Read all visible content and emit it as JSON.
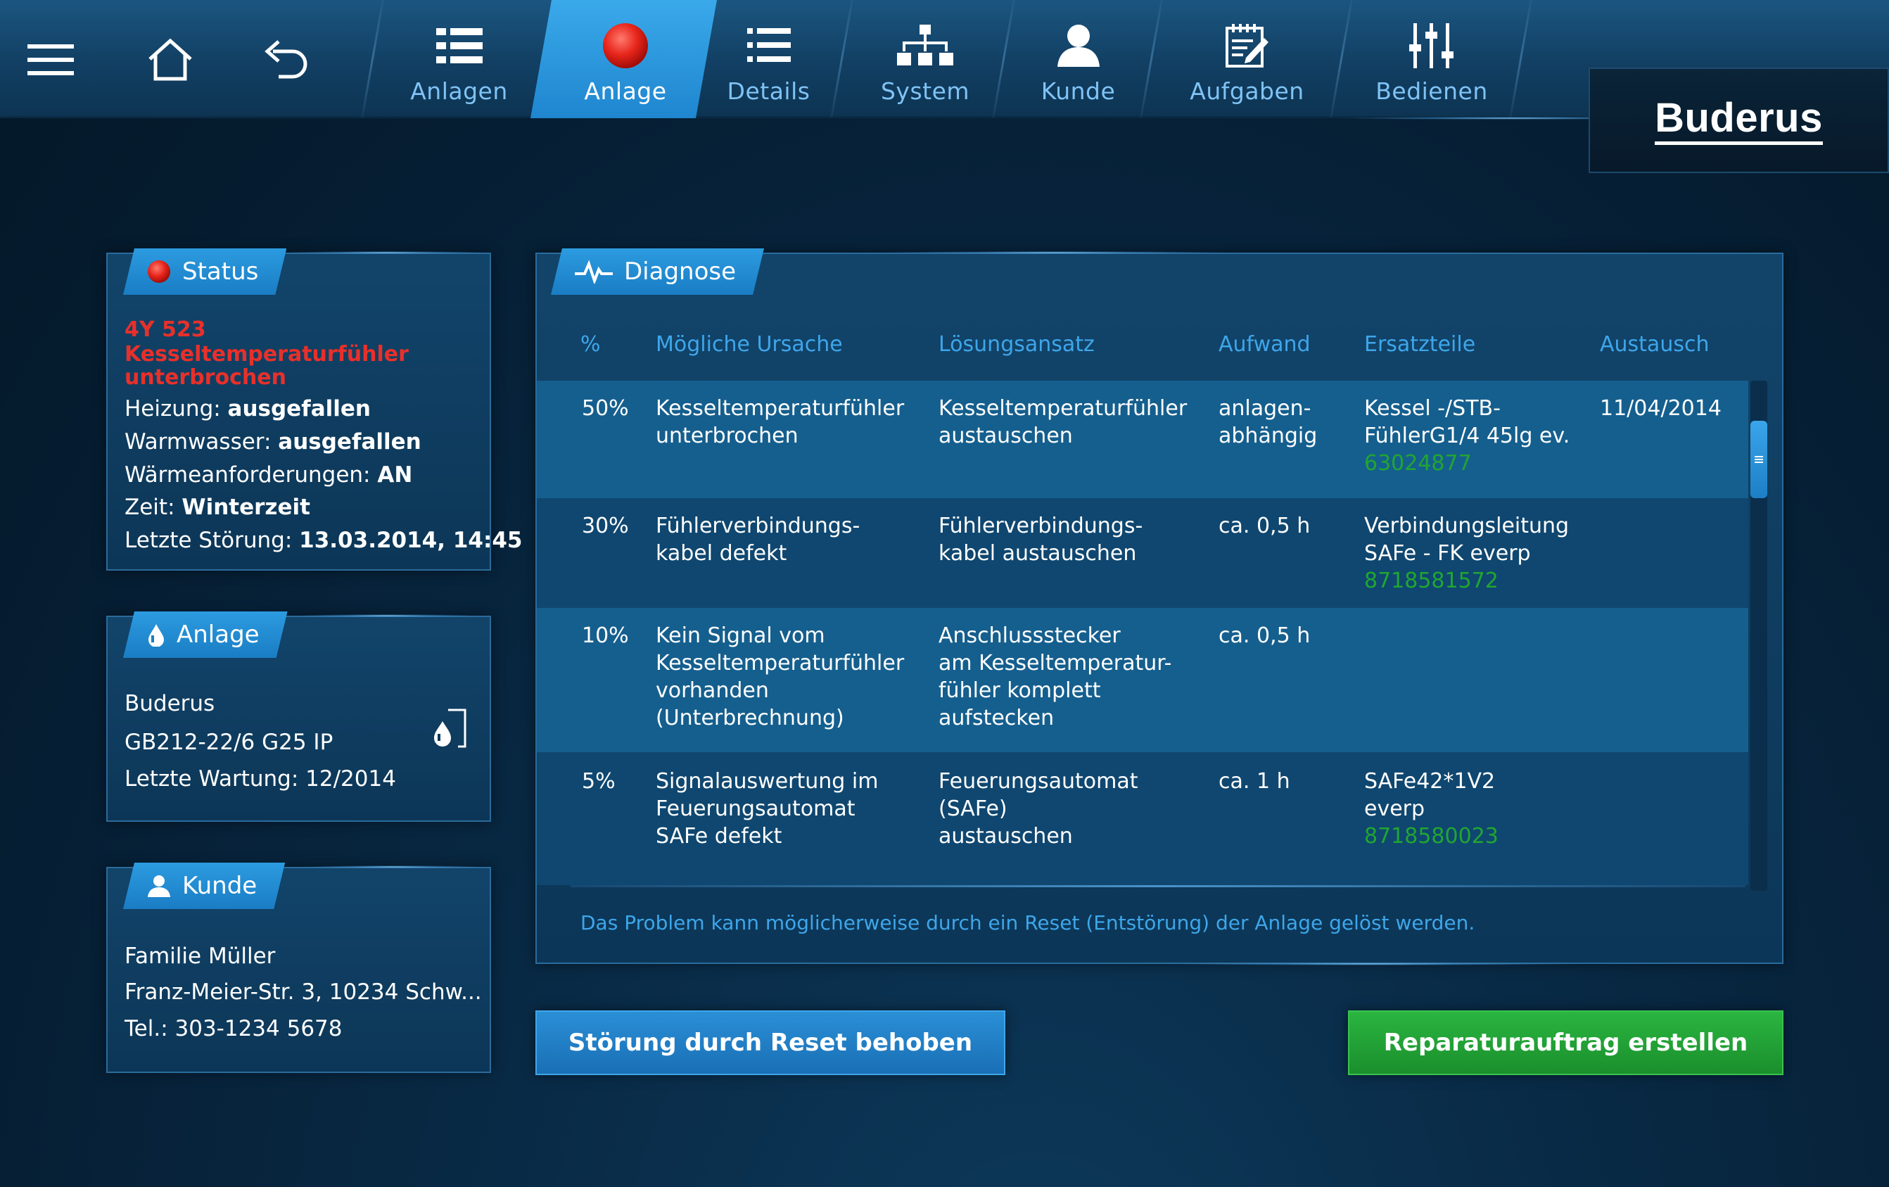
{
  "nav": {
    "tabs": [
      {
        "label": "Anlagen",
        "icon": "grid-icon"
      },
      {
        "label": "Anlage",
        "icon": "red-dot-icon"
      },
      {
        "label": "Details",
        "icon": "list-icon"
      },
      {
        "label": "System",
        "icon": "hierarchy-icon"
      },
      {
        "label": "Kunde",
        "icon": "person-icon"
      },
      {
        "label": "Aufgaben",
        "icon": "task-edit-icon"
      },
      {
        "label": "Bedienen",
        "icon": "sliders-icon"
      }
    ],
    "active_tab": "Anlage",
    "brand": "Buderus"
  },
  "status": {
    "title": "Status",
    "error_code": "4Y 523",
    "error_line1": "Kesseltemperaturfühler",
    "error_line2": "unterbrochen",
    "heizung_label": "Heizung:",
    "heizung_value": "ausgefallen",
    "warmwasser_label": "Warmwasser:",
    "warmwasser_value": "ausgefallen",
    "waerme_label": "Wärmeanforderungen:",
    "waerme_value": "AN",
    "zeit_label": "Zeit:",
    "zeit_value": "Winterzeit",
    "stoerung_label": "Letzte Störung:",
    "stoerung_value": "13.03.2014, 14:45"
  },
  "anlage": {
    "title": "Anlage",
    "maker": "Buderus",
    "model": "GB212-22/6 G25 IP",
    "wartung": "Letzte Wartung: 12/2014"
  },
  "kunde": {
    "title": "Kunde",
    "name": "Familie Müller",
    "address": "Franz-Meier-Str. 3, 10234 Schw...",
    "phone": "Tel.: 303-1234 5678"
  },
  "diagnose": {
    "title": "Diagnose",
    "headers": [
      "%",
      "Mögliche Ursache",
      "Lösungsansatz",
      "Aufwand",
      "Ersatzteile",
      "Austausch"
    ],
    "rows": [
      {
        "pct": "50%",
        "ursache": [
          "Kesseltemperaturfühler",
          "unterbrochen"
        ],
        "loesung": [
          "Kesseltemperaturfühler",
          "austauschen"
        ],
        "aufwand": [
          "anlagen-",
          "abhängig"
        ],
        "teile": [
          "Kessel -/STB-",
          "FühlerG1/4 45lg ev."
        ],
        "teilnr": "63024877",
        "austausch": "11/04/2014"
      },
      {
        "pct": "30%",
        "ursache": [
          "Fühlerverbindungs-",
          "kabel defekt"
        ],
        "loesung": [
          "Fühlerverbindungs-",
          "kabel austauschen"
        ],
        "aufwand": [
          "ca. 0,5 h"
        ],
        "teile": [
          "Verbindungsleitung",
          "SAFe - FK everp"
        ],
        "teilnr": "8718581572",
        "austausch": ""
      },
      {
        "pct": "10%",
        "ursache": [
          "Kein Signal vom",
          "Kesseltemperaturfühler",
          "vorhanden",
          "(Unterbrechnung)"
        ],
        "loesung": [
          "Anschlussstecker",
          "am Kesseltemperatur-",
          "fühler komplett",
          "aufstecken"
        ],
        "aufwand": [
          "ca. 0,5 h"
        ],
        "teile": [],
        "teilnr": "",
        "austausch": ""
      },
      {
        "pct": "5%",
        "ursache": [
          "Signalauswertung im",
          "Feuerungsautomat",
          "SAFe defekt"
        ],
        "loesung": [
          "Feuerungsautomat",
          "(SAFe)",
          "austauschen"
        ],
        "aufwand": [
          "ca. 1 h"
        ],
        "teile": [
          "SAFe42*1V2",
          "everp"
        ],
        "teilnr": "8718580023",
        "austausch": ""
      }
    ],
    "hint": "Das Problem kann möglicherweise durch ein Reset (Entstörung) der Anlage gelöst werden."
  },
  "buttons": {
    "reset": "Störung durch Reset behoben",
    "repair": "Reparaturauftrag erstellen"
  },
  "colors": {
    "accent_blue": "#2c9be0",
    "error_red": "#e8302a",
    "part_green": "#21a531",
    "repair_button": "#1f9a33",
    "header_blue": "#3ea6ea"
  }
}
